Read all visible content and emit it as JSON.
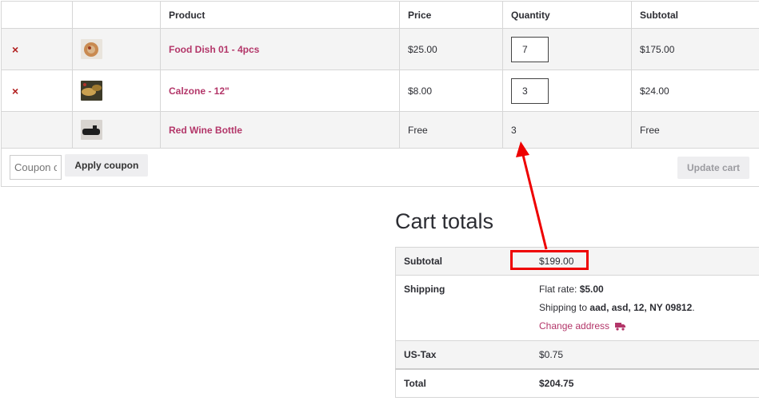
{
  "cart": {
    "headers": {
      "product": "Product",
      "price": "Price",
      "quantity": "Quantity",
      "subtotal": "Subtotal"
    },
    "remove_symbol": "×",
    "items": [
      {
        "name": "Food Dish 01 - 4pcs",
        "price": "$25.00",
        "quantity": "7",
        "subtotal": "$175.00",
        "thumb_color": "#c9a27a"
      },
      {
        "name": "Calzone - 12\"",
        "price": "$8.00",
        "quantity": "3",
        "subtotal": "$24.00",
        "thumb_color": "#8a7a3a"
      },
      {
        "name": "Red Wine Bottle",
        "price": "Free",
        "quantity": "3",
        "subtotal": "Free",
        "thumb_color": "#3a3a3a"
      }
    ],
    "coupon_placeholder": "Coupon code",
    "apply_coupon_label": "Apply coupon",
    "update_cart_label": "Update cart"
  },
  "totals": {
    "heading": "Cart totals",
    "subtotal_label": "Subtotal",
    "subtotal_value": "$199.00",
    "shipping_label": "Shipping",
    "flat_rate_prefix": "Flat rate:",
    "flat_rate_value": "$5.00",
    "shipping_to_prefix": "Shipping to",
    "shipping_to_address": "aad, asd, 12, NY 09812",
    "shipping_to_suffix": ".",
    "change_address": "Change address",
    "tax_label": "US-Tax",
    "tax_value": "$0.75",
    "total_label": "Total",
    "total_value": "$204.75"
  },
  "colors": {
    "accent": "#b33669",
    "remove": "#b11d1d",
    "annotation": "#ee0000"
  }
}
